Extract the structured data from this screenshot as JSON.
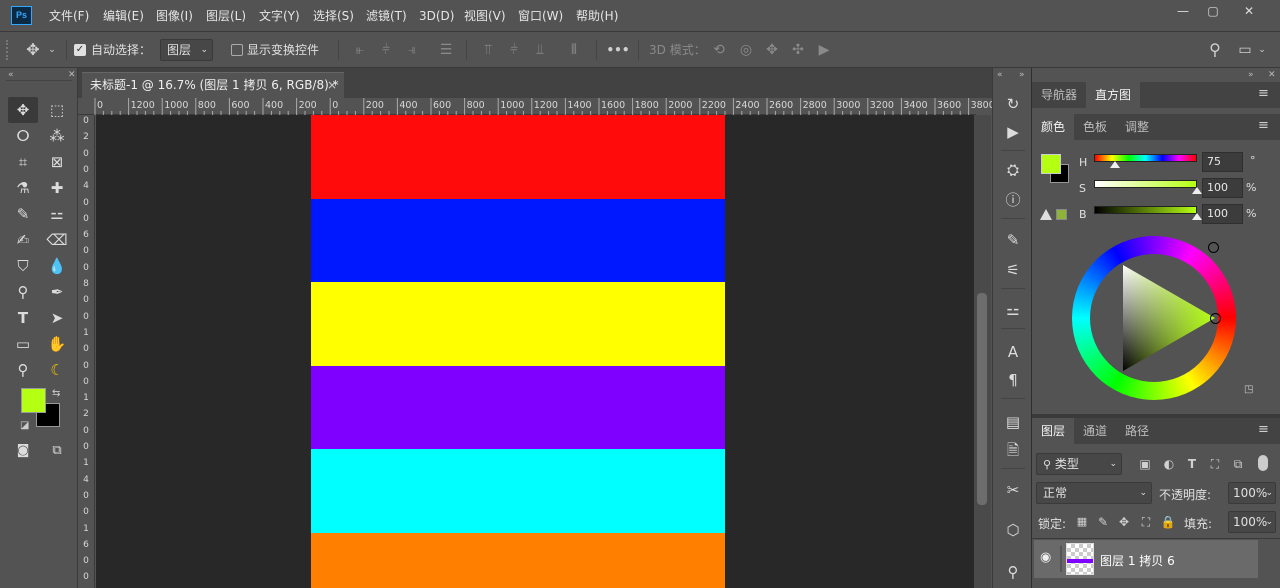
{
  "app": {
    "logo": "Ps"
  },
  "menu": [
    "文件(F)",
    "编辑(E)",
    "图像(I)",
    "图层(L)",
    "文字(Y)",
    "选择(S)",
    "滤镜(T)",
    "3D(D)",
    "视图(V)",
    "窗口(W)",
    "帮助(H)"
  ],
  "window": {
    "minimize": "—",
    "maximize": "▢",
    "close": "✕"
  },
  "options": {
    "auto_select_label": "自动选择：",
    "auto_select_target": "图层",
    "transform_controls_label": "显示变换控件",
    "more": "•••",
    "mode_3d_label": "3D 模式："
  },
  "document": {
    "tab_title": "未标题-1 @ 16.7% (图层 1 拷贝 6, RGB/8) *",
    "tab_close": "×"
  },
  "ruler": {
    "h": [
      "0",
      "1200",
      "1000",
      "800",
      "600",
      "400",
      "200",
      "0",
      "200",
      "400",
      "600",
      "800",
      "1000",
      "1200",
      "1400",
      "1600",
      "1800",
      "2000",
      "2200",
      "2400",
      "2600",
      "2800",
      "3000",
      "3200",
      "3400",
      "3600",
      "3800"
    ],
    "v": [
      "0",
      "2",
      "0",
      "0",
      "4",
      "0",
      "0",
      "6",
      "0",
      "0",
      "8",
      "0",
      "0",
      "1",
      "0",
      "0",
      "0",
      "1",
      "2",
      "0",
      "0",
      "1",
      "4",
      "0",
      "0",
      "1",
      "6",
      "0",
      "0"
    ]
  },
  "canvas": {
    "stripes": [
      "#ff0b0b",
      "#0018ff",
      "#ffff00",
      "#7f00ff",
      "#00ffff",
      "#ff7f00"
    ]
  },
  "colors": {
    "foreground": "#b5ff12",
    "background": "#000000",
    "gamut_swatch": "#8fb33a"
  },
  "nav_panel": {
    "tabs": [
      "导航器",
      "直方图"
    ],
    "active": 1
  },
  "color_panel": {
    "tabs": [
      "颜色",
      "色板",
      "调整"
    ],
    "active": 0,
    "h": {
      "label": "H",
      "value": "75",
      "unit": "°"
    },
    "s": {
      "label": "S",
      "value": "100",
      "unit": "%"
    },
    "b": {
      "label": "B",
      "value": "100",
      "unit": "%"
    },
    "h_fraction": 0.208,
    "s_fraction": 1.0,
    "b_fraction": 1.0
  },
  "layers_panel": {
    "tabs": [
      "图层",
      "通道",
      "路径"
    ],
    "active": 0,
    "filter_kind": "类型",
    "blend_mode": "正常",
    "opacity_label": "不透明度:",
    "opacity": "100%",
    "lock_label": "锁定:",
    "fill_label": "填充:",
    "fill": "100%",
    "layers": [
      {
        "name": "图层 1 拷贝 6",
        "visible": true,
        "selected": true
      }
    ]
  }
}
